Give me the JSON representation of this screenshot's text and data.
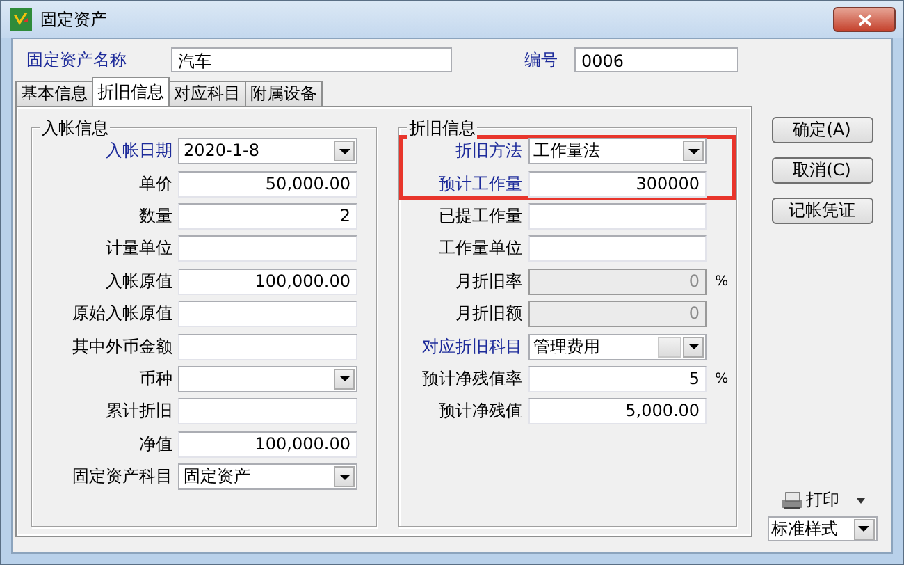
{
  "window": {
    "title": "固定资产"
  },
  "header_fields": [
    {
      "label": "固定资产名称",
      "value": "汽车",
      "required": true
    },
    {
      "label": "编号",
      "value": "0006",
      "required": true
    }
  ],
  "tabs": [
    {
      "label": "基本信息",
      "selected": false
    },
    {
      "label": "折旧信息",
      "selected": true
    },
    {
      "label": "对应科目",
      "selected": false
    },
    {
      "label": "附属设备",
      "selected": false
    }
  ],
  "groups": [
    {
      "title": "入帐信息",
      "fields": [
        {
          "label": "入帐日期",
          "kind": "combo",
          "value": "2020-1-8",
          "required": true,
          "readonly": false,
          "highlighted": false
        },
        {
          "label": "单价",
          "kind": "number",
          "value": "50,000.00",
          "required": false,
          "readonly": false,
          "highlighted": false
        },
        {
          "label": "数量",
          "kind": "number",
          "value": "2",
          "required": false,
          "readonly": false,
          "highlighted": false
        },
        {
          "label": "计量单位",
          "kind": "text",
          "required": false,
          "readonly": false,
          "highlighted": false
        },
        {
          "label": "入帐原值",
          "kind": "number",
          "value": "100,000.00",
          "required": false,
          "readonly": false,
          "highlighted": false
        },
        {
          "label": "原始入帐原值",
          "kind": "text",
          "required": false,
          "readonly": false,
          "highlighted": false
        },
        {
          "label": "其中外币金额",
          "kind": "text",
          "required": false,
          "readonly": false,
          "highlighted": false
        },
        {
          "label": "币种",
          "kind": "combo",
          "required": false,
          "readonly": false,
          "highlighted": false
        },
        {
          "label": "累计折旧",
          "kind": "text",
          "required": false,
          "readonly": false,
          "highlighted": false
        },
        {
          "label": "净值",
          "kind": "number",
          "value": "100,000.00",
          "required": false,
          "readonly": false,
          "highlighted": false
        },
        {
          "label": "固定资产科目",
          "kind": "combo",
          "value": "固定资产",
          "required": false,
          "readonly": false,
          "highlighted": false
        }
      ]
    },
    {
      "title": "折旧信息",
      "fields": [
        {
          "label": "折旧方法",
          "kind": "combo",
          "value": "工作量法",
          "required": true,
          "readonly": false,
          "highlighted": true
        },
        {
          "label": "预计工作量",
          "kind": "number",
          "value": "300000",
          "required": true,
          "readonly": false,
          "highlighted": true
        },
        {
          "label": "已提工作量",
          "kind": "text",
          "required": false,
          "readonly": false,
          "highlighted": false
        },
        {
          "label": "工作量单位",
          "kind": "text",
          "required": false,
          "readonly": false,
          "highlighted": false
        },
        {
          "label": "月折旧率",
          "kind": "number",
          "value": "0",
          "unit": "%",
          "required": false,
          "readonly": true,
          "highlighted": false
        },
        {
          "label": "月折旧额",
          "kind": "number",
          "value": "0",
          "required": false,
          "readonly": true,
          "highlighted": false
        },
        {
          "label": "对应折旧科目",
          "kind": "lookup",
          "value": "管理费用",
          "required": true,
          "readonly": false,
          "highlighted": false
        },
        {
          "label": "预计净残值率",
          "kind": "number",
          "value": "5",
          "unit": "%",
          "required": false,
          "readonly": false,
          "highlighted": false
        },
        {
          "label": "预计净残值",
          "kind": "number",
          "value": "5,000.00",
          "required": false,
          "readonly": false,
          "highlighted": false
        }
      ]
    }
  ],
  "buttons": [
    {
      "label": "确定(A)"
    },
    {
      "label": "取消(C)"
    },
    {
      "label": "记帐凭证"
    }
  ],
  "print": {
    "label": "打印",
    "style": "标准样式"
  }
}
